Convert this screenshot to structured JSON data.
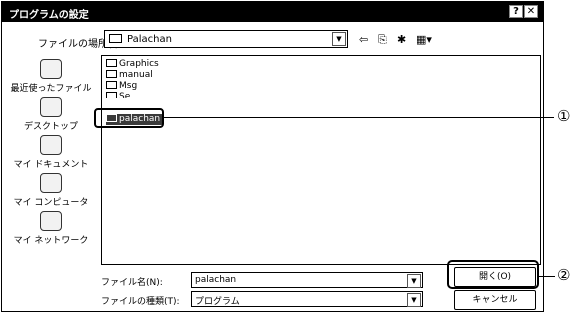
{
  "window": {
    "title": "プログラムの設定",
    "help_label": "?",
    "close_label": "✕"
  },
  "look_in": {
    "label": "ファイルの場所(I):",
    "value": "Palachan"
  },
  "toolbar": {
    "back_glyph": "⇦",
    "up_glyph": "⎘",
    "new_folder_glyph": "✱",
    "view_glyph": "▦▾"
  },
  "places": [
    {
      "label": "最近使ったファイル",
      "icon": "recent-documents-icon"
    },
    {
      "label": "デスクトップ",
      "icon": "desktop-icon"
    },
    {
      "label": "マイ ドキュメント",
      "icon": "my-documents-icon"
    },
    {
      "label": "マイ コンピュータ",
      "icon": "my-computer-icon"
    },
    {
      "label": "マイ ネットワーク",
      "icon": "my-network-icon"
    }
  ],
  "files": [
    {
      "name": "Graphics",
      "type": "folder"
    },
    {
      "name": "manual",
      "type": "folder"
    },
    {
      "name": "Msg",
      "type": "folder"
    },
    {
      "name": "Se",
      "type": "folder"
    },
    {
      "name": "palachan",
      "type": "program",
      "selected": true
    }
  ],
  "filename": {
    "label": "ファイル名(N):",
    "value": "palachan"
  },
  "filetype": {
    "label": "ファイルの種類(T):",
    "value": "プログラム"
  },
  "buttons": {
    "open": "開く(O)",
    "cancel": "キャンセル"
  },
  "callouts": {
    "one": "①",
    "two": "②"
  }
}
